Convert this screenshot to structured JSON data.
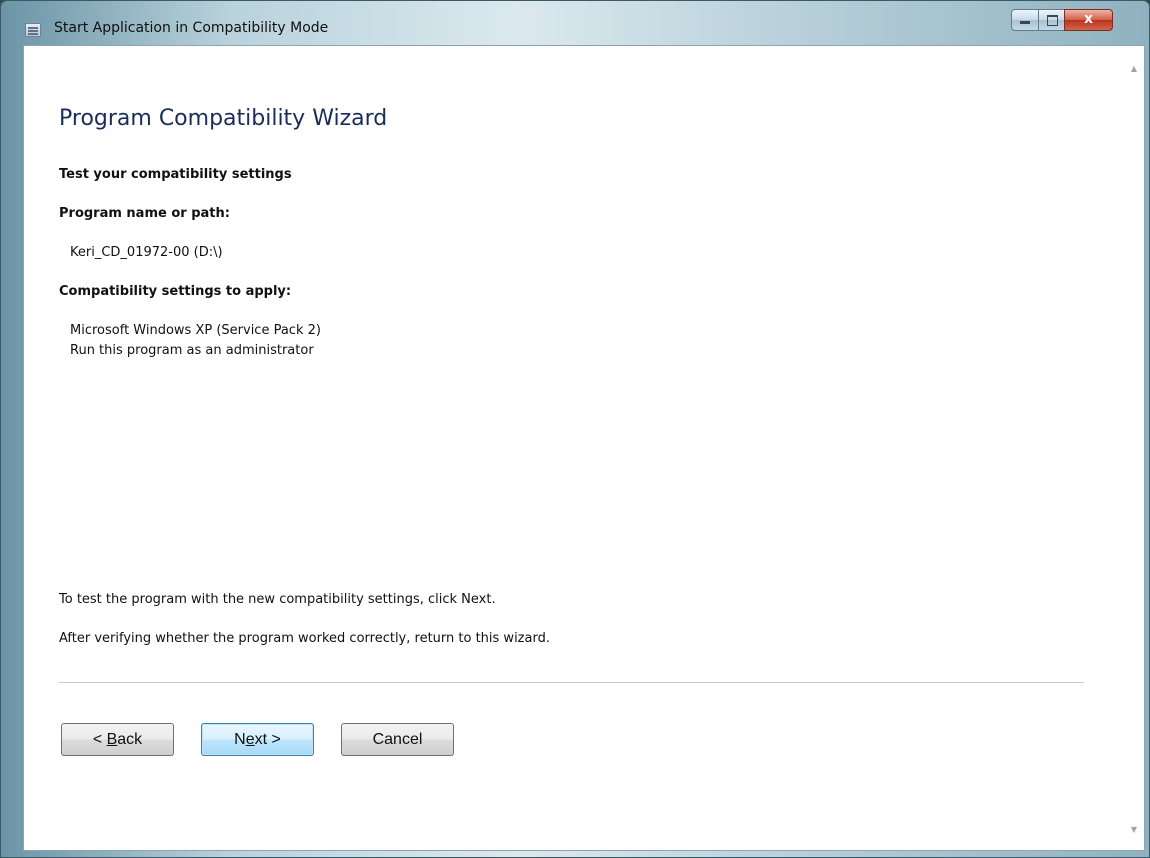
{
  "window": {
    "title": "Start Application in Compatibility Mode",
    "controls": {
      "minimize_icon": "minimize-icon",
      "maximize_icon": "maximize-icon",
      "close_icon": "close-icon",
      "close_glyph": "x"
    }
  },
  "wizard": {
    "title": "Program Compatibility Wizard",
    "subtitle": "Test your compatibility settings",
    "program_label": "Program name or path:",
    "program_value": "Keri_CD_01972-00 (D:\\)",
    "settings_label": "Compatibility settings to apply:",
    "settings": [
      "Microsoft Windows XP (Service Pack 2)",
      "Run this program as an administrator"
    ],
    "instruction_1": "To test the program with the new compatibility settings, click Next.",
    "instruction_2": "After verifying whether the program worked correctly, return to this wizard."
  },
  "buttons": {
    "back": {
      "prefix": "< ",
      "mnemonic": "B",
      "suffix": "ack"
    },
    "next": {
      "prefix": "N",
      "mnemonic": "e",
      "suffix": "xt >"
    },
    "cancel": "Cancel"
  },
  "colors": {
    "heading": "#1b2c59",
    "default_button": "#bee6fd",
    "close_button": "#c0392b"
  }
}
